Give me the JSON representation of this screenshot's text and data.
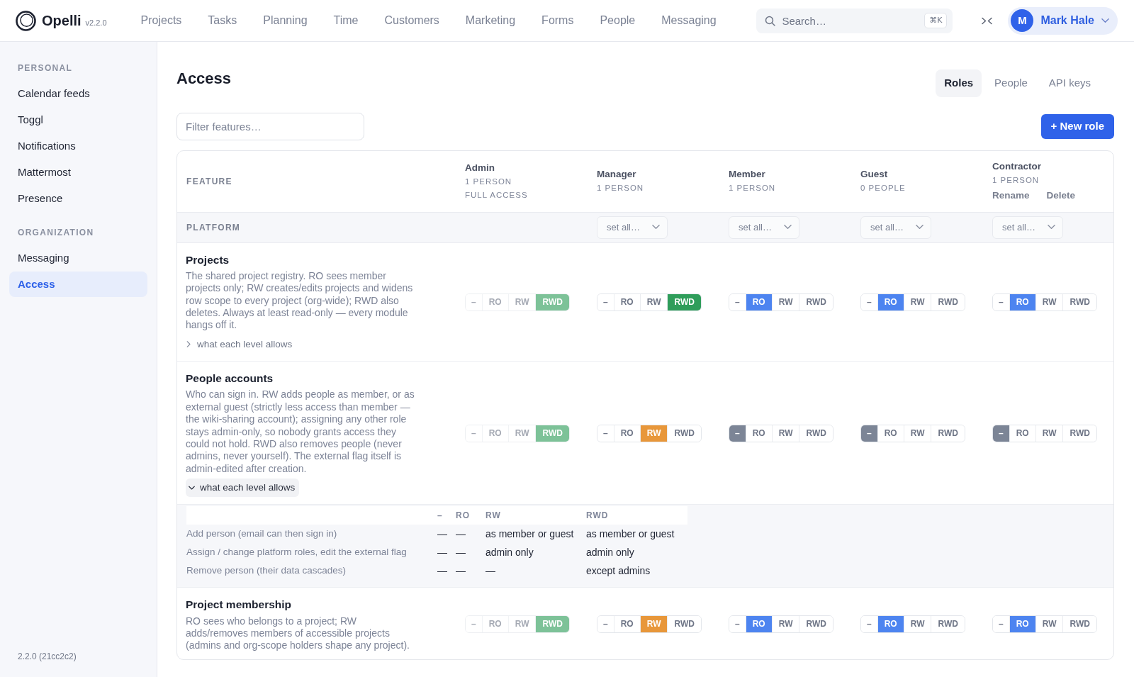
{
  "app": {
    "name": "Opelli",
    "version": "v2.2.0"
  },
  "nav": [
    "Projects",
    "Tasks",
    "Planning",
    "Time",
    "Customers",
    "Marketing",
    "Forms",
    "People",
    "Messaging"
  ],
  "search": {
    "placeholder": "Search…",
    "shortcut": "⌘K"
  },
  "user": {
    "initial": "M",
    "name": "Mark Hale"
  },
  "sidebar": {
    "sections": [
      {
        "heading": "PERSONAL",
        "items": [
          {
            "label": "Calendar feeds",
            "selected": false
          },
          {
            "label": "Toggl",
            "selected": false
          },
          {
            "label": "Notifications",
            "selected": false
          },
          {
            "label": "Mattermost",
            "selected": false
          },
          {
            "label": "Presence",
            "selected": false
          }
        ]
      },
      {
        "heading": "ORGANIZATION",
        "items": [
          {
            "label": "Messaging",
            "selected": false
          },
          {
            "label": "Access",
            "selected": true
          }
        ]
      }
    ],
    "footer": "2.2.0 (21cc2c2)"
  },
  "page": {
    "title": "Access",
    "tabs": [
      {
        "label": "Roles",
        "selected": true
      },
      {
        "label": "People",
        "selected": false
      },
      {
        "label": "API keys",
        "selected": false
      }
    ],
    "filter": {
      "placeholder": "Filter features…"
    },
    "new_role_button": "+ New role"
  },
  "matrix": {
    "feature_heading": "FEATURE",
    "roles": [
      {
        "name": "Admin",
        "details": [
          "1 PERSON",
          "FULL ACCESS"
        ],
        "locked": true
      },
      {
        "name": "Manager",
        "details": [
          "1 PERSON"
        ],
        "locked": false
      },
      {
        "name": "Member",
        "details": [
          "1 PERSON"
        ],
        "locked": false
      },
      {
        "name": "Guest",
        "details": [
          "0 PEOPLE"
        ],
        "locked": false
      },
      {
        "name": "Contractor",
        "details": [
          "1 PERSON"
        ],
        "actions": [
          "Rename",
          "Delete"
        ],
        "locked": false
      }
    ],
    "groups": [
      {
        "label": "PLATFORM",
        "set_all": [
          "set all…",
          "set all…",
          "set all…",
          "set all…"
        ],
        "features": [
          {
            "name": "Projects",
            "description": "The shared project registry. RO sees member projects only; RW creates/edits projects and widens row scope to every project (org-wide); RWD also deletes. Always at least read-only — every module hangs off it.",
            "expander": {
              "label": "what each level allows",
              "expanded": false
            },
            "cells": [
              {
                "options": [
                  {
                    "label": "–",
                    "selected": false
                  },
                  {
                    "label": "RO",
                    "selected": false
                  },
                  {
                    "label": "RW",
                    "selected": false
                  },
                  {
                    "label": "RWD",
                    "selected": true
                  }
                ]
              },
              {
                "options": [
                  {
                    "label": "–",
                    "selected": false
                  },
                  {
                    "label": "RO",
                    "selected": false
                  },
                  {
                    "label": "RW",
                    "selected": false
                  },
                  {
                    "label": "RWD",
                    "selected": true
                  }
                ]
              },
              {
                "options": [
                  {
                    "label": "–",
                    "selected": false
                  },
                  {
                    "label": "RO",
                    "selected": true
                  },
                  {
                    "label": "RW",
                    "selected": false
                  },
                  {
                    "label": "RWD",
                    "selected": false
                  }
                ]
              },
              {
                "options": [
                  {
                    "label": "–",
                    "selected": false
                  },
                  {
                    "label": "RO",
                    "selected": true
                  },
                  {
                    "label": "RW",
                    "selected": false
                  },
                  {
                    "label": "RWD",
                    "selected": false
                  }
                ]
              },
              {
                "options": [
                  {
                    "label": "–",
                    "selected": false
                  },
                  {
                    "label": "RO",
                    "selected": true
                  },
                  {
                    "label": "RW",
                    "selected": false
                  },
                  {
                    "label": "RWD",
                    "selected": false
                  }
                ]
              }
            ]
          },
          {
            "name": "People accounts",
            "description": "Who can sign in. RW adds people as member, or as external guest (strictly less access than member — the wiki-sharing account); assigning any other role stays admin-only, so nobody grants access they could not hold. RWD also removes people (never admins, never yourself). The external flag itself is admin-edited after creation.",
            "expander": {
              "label": "what each level allows",
              "expanded": true
            },
            "cells": [
              {
                "options": [
                  {
                    "label": "–",
                    "selected": false
                  },
                  {
                    "label": "RO",
                    "selected": false
                  },
                  {
                    "label": "RW",
                    "selected": false
                  },
                  {
                    "label": "RWD",
                    "selected": true
                  }
                ]
              },
              {
                "options": [
                  {
                    "label": "–",
                    "selected": false
                  },
                  {
                    "label": "RO",
                    "selected": false
                  },
                  {
                    "label": "RW",
                    "selected": true
                  },
                  {
                    "label": "RWD",
                    "selected": false
                  }
                ]
              },
              {
                "options": [
                  {
                    "label": "–",
                    "selected": true
                  },
                  {
                    "label": "RO",
                    "selected": false
                  },
                  {
                    "label": "RW",
                    "selected": false
                  },
                  {
                    "label": "RWD",
                    "selected": false
                  }
                ]
              },
              {
                "options": [
                  {
                    "label": "–",
                    "selected": true
                  },
                  {
                    "label": "RO",
                    "selected": false
                  },
                  {
                    "label": "RW",
                    "selected": false
                  },
                  {
                    "label": "RWD",
                    "selected": false
                  }
                ]
              },
              {
                "options": [
                  {
                    "label": "–",
                    "selected": true
                  },
                  {
                    "label": "RO",
                    "selected": false
                  },
                  {
                    "label": "RW",
                    "selected": false
                  },
                  {
                    "label": "RWD",
                    "selected": false
                  }
                ]
              }
            ],
            "details": {
              "columns": [
                "–",
                "RO",
                "RW",
                "RWD"
              ],
              "rows": [
                {
                  "action": "Add person (email can then sign in)",
                  "values": [
                    "—",
                    "—",
                    "as member or guest",
                    "as member or guest"
                  ]
                },
                {
                  "action": "Assign / change platform roles, edit the external flag",
                  "values": [
                    "—",
                    "—",
                    "admin only",
                    "admin only"
                  ]
                },
                {
                  "action": "Remove person (their data cascades)",
                  "values": [
                    "—",
                    "—",
                    "—",
                    "except admins"
                  ]
                }
              ]
            }
          },
          {
            "name": "Project membership",
            "description": "RO sees who belongs to a project; RW adds/removes members of accessible projects (admins and org-scope holders shape any project).",
            "cells": [
              {
                "options": [
                  {
                    "label": "–",
                    "selected": false
                  },
                  {
                    "label": "RO",
                    "selected": false
                  },
                  {
                    "label": "RW",
                    "selected": false
                  },
                  {
                    "label": "RWD",
                    "selected": true
                  }
                ]
              },
              {
                "options": [
                  {
                    "label": "–",
                    "selected": false
                  },
                  {
                    "label": "RO",
                    "selected": false
                  },
                  {
                    "label": "RW",
                    "selected": true
                  },
                  {
                    "label": "RWD",
                    "selected": false
                  }
                ]
              },
              {
                "options": [
                  {
                    "label": "–",
                    "selected": false
                  },
                  {
                    "label": "RO",
                    "selected": true
                  },
                  {
                    "label": "RW",
                    "selected": false
                  },
                  {
                    "label": "RWD",
                    "selected": false
                  }
                ]
              },
              {
                "options": [
                  {
                    "label": "–",
                    "selected": false
                  },
                  {
                    "label": "RO",
                    "selected": true
                  },
                  {
                    "label": "RW",
                    "selected": false
                  },
                  {
                    "label": "RWD",
                    "selected": false
                  }
                ]
              },
              {
                "options": [
                  {
                    "label": "–",
                    "selected": false
                  },
                  {
                    "label": "RO",
                    "selected": true
                  },
                  {
                    "label": "RW",
                    "selected": false
                  },
                  {
                    "label": "RWD",
                    "selected": false
                  }
                ]
              }
            ]
          }
        ]
      }
    ]
  }
}
